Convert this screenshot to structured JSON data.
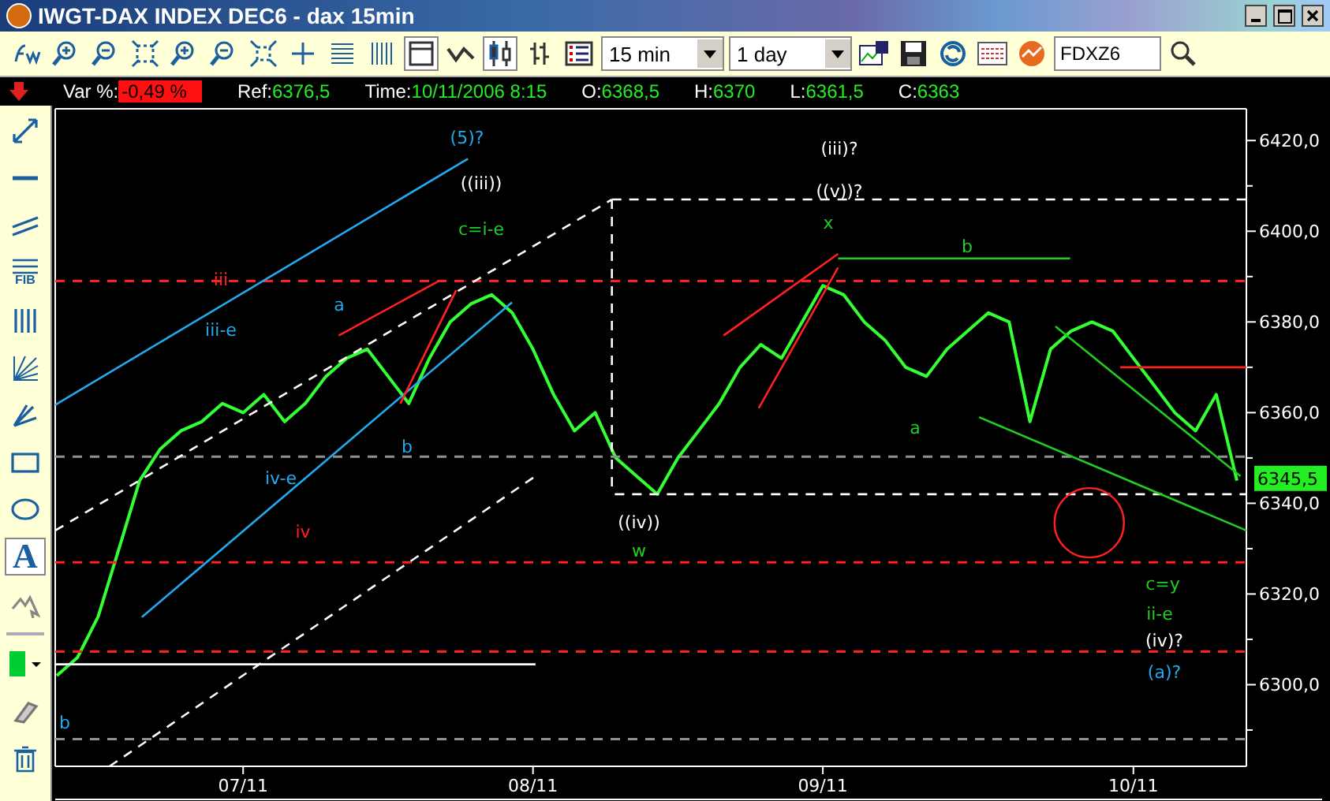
{
  "window": {
    "title": "IWGT-DAX INDEX DEC6 - dax 15min"
  },
  "toolbar": {
    "buttons": [
      {
        "selected": false
      },
      {
        "selected": false
      },
      {
        "selected": false
      },
      {
        "selected": false
      },
      {
        "selected": false
      },
      {
        "selected": false
      },
      {
        "selected": false
      },
      {
        "selected": false
      },
      {
        "selected": false
      },
      {
        "selected": false
      },
      {
        "selected": true
      },
      {
        "selected": false
      },
      {
        "selected": true
      },
      {
        "selected": false
      },
      {
        "selected": false
      }
    ],
    "interval": "15 min",
    "period": "1 day",
    "symbol": "FDXZ6"
  },
  "info_bar": {
    "fields": [
      {
        "label": "Var %:",
        "value": "-0,49 %",
        "kind": "alert"
      },
      {
        "label": "Ref:",
        "value": "6376,5",
        "kind": "plain"
      },
      {
        "label": "Time:",
        "value": "10/11/2006 8:15",
        "kind": "plain"
      },
      {
        "label": "O:",
        "value": "6368,5",
        "kind": "plain"
      },
      {
        "label": "H:",
        "value": "6370",
        "kind": "plain"
      },
      {
        "label": "L:",
        "value": "6361,5",
        "kind": "plain"
      },
      {
        "label": "C:",
        "value": "6363",
        "kind": "plain"
      }
    ]
  },
  "drawing_tools": [
    {
      "kind": "arrow",
      "selected": false
    },
    {
      "kind": "hline",
      "selected": false
    },
    {
      "kind": "parallel",
      "selected": false
    },
    {
      "kind": "fib",
      "label": "FIB",
      "selected": false
    },
    {
      "kind": "vlines",
      "selected": false
    },
    {
      "kind": "fan",
      "selected": false
    },
    {
      "kind": "fan2",
      "selected": false
    },
    {
      "kind": "rect",
      "selected": false
    },
    {
      "kind": "ellipse",
      "selected": false
    },
    {
      "kind": "text",
      "label": "A",
      "selected": true
    },
    {
      "kind": "pointer",
      "selected": false
    },
    {
      "kind": "color",
      "color": "#00cc33",
      "selected": false
    },
    {
      "kind": "eraser",
      "selected": false
    },
    {
      "kind": "trash",
      "selected": false
    }
  ],
  "chart": {
    "last_price": "6345,5",
    "wave_labels": [
      {
        "text": "(5)?",
        "color": "#22aaee"
      },
      {
        "text": "((iii))",
        "color": "#ffffff"
      },
      {
        "text": "c=i-e",
        "color": "#22cc22"
      },
      {
        "text": "iii",
        "color": "#ff2020"
      },
      {
        "text": "iii-e",
        "color": "#22aaee"
      },
      {
        "text": "a",
        "color": "#22aaee"
      },
      {
        "text": "b",
        "color": "#22aaee"
      },
      {
        "text": "iv-e",
        "color": "#22aaee"
      },
      {
        "text": "iv",
        "color": "#ff2020"
      },
      {
        "text": "b",
        "color": "#22aaee"
      },
      {
        "text": "((iv))",
        "color": "#ffffff"
      },
      {
        "text": "w",
        "color": "#22cc22"
      },
      {
        "text": "(iii)?",
        "color": "#ffffff"
      },
      {
        "text": "((v))?",
        "color": "#ffffff"
      },
      {
        "text": "x",
        "color": "#22cc22"
      },
      {
        "text": "b",
        "color": "#22cc22"
      },
      {
        "text": "a",
        "color": "#22cc22"
      },
      {
        "text": "c=y",
        "color": "#22cc22"
      },
      {
        "text": "ii-e",
        "color": "#22cc22"
      },
      {
        "text": "(iv)?",
        "color": "#ffffff"
      },
      {
        "text": "(a)?",
        "color": "#22aaee"
      }
    ],
    "chart_data": {
      "type": "line",
      "ylim": [
        6282,
        6427
      ],
      "yticks": [
        {
          "value": 6300,
          "label": "6300,0"
        },
        {
          "value": 6320,
          "label": "6320,0"
        },
        {
          "value": 6340,
          "label": "6340,0"
        },
        {
          "value": 6360,
          "label": "6360,0"
        },
        {
          "value": 6380,
          "label": "6380,0"
        },
        {
          "value": 6400,
          "label": "6400,0"
        },
        {
          "value": 6420,
          "label": "6420,0"
        }
      ],
      "categories": [
        null,
        null,
        null,
        null,
        null,
        null,
        null,
        null,
        null,
        "07/11",
        null,
        null,
        null,
        null,
        null,
        null,
        null,
        null,
        null,
        null,
        null,
        null,
        null,
        "08/11",
        null,
        null,
        null,
        null,
        null,
        null,
        null,
        null,
        null,
        null,
        null,
        null,
        null,
        "09/11",
        null,
        null,
        null,
        null,
        null,
        null,
        null,
        null,
        null,
        null,
        null,
        null,
        null,
        null,
        "10/11",
        null,
        null,
        null,
        null,
        null
      ],
      "series": [
        {
          "color": "#33ff33",
          "values": [
            6302,
            6306,
            6315,
            6330,
            6345,
            6352,
            6356,
            6358,
            6362,
            6360,
            6364,
            6358,
            6362,
            6368,
            6372,
            6374,
            6368,
            6362,
            6372,
            6380,
            6384,
            6386,
            6382,
            6374,
            6364,
            6356,
            6360,
            6350,
            6346,
            6342,
            6350,
            6356,
            6362,
            6370,
            6375,
            6372,
            6380,
            6388,
            6386,
            6380,
            6376,
            6370,
            6368,
            6374,
            6378,
            6382,
            6380,
            6358,
            6374,
            6378,
            6380,
            6378,
            6372,
            6366,
            6360,
            6356,
            6364,
            6345
          ]
        }
      ]
    }
  }
}
